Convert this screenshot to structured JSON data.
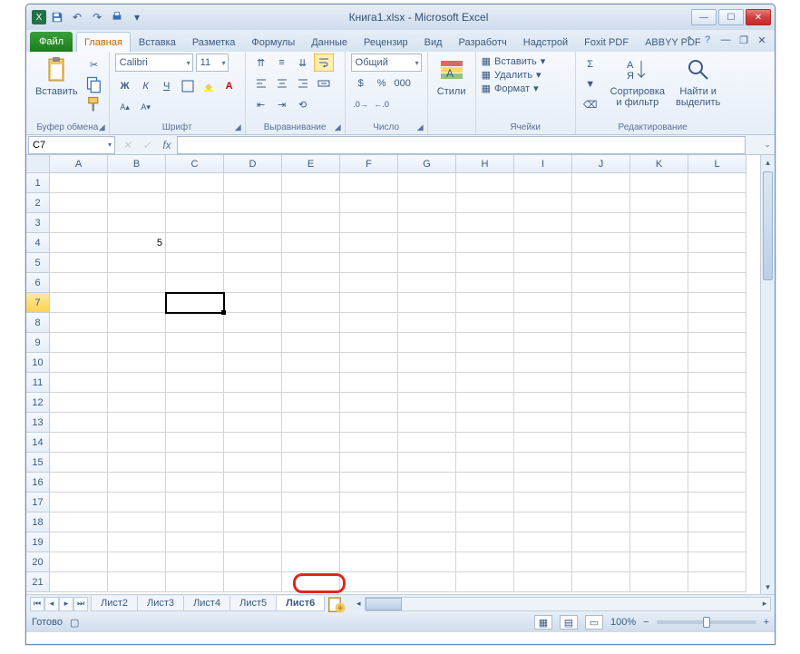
{
  "titlebar": {
    "title": "Книга1.xlsx - Microsoft Excel"
  },
  "tabs": {
    "file": "Файл",
    "items": [
      "Главная",
      "Вставка",
      "Разметка",
      "Формулы",
      "Данные",
      "Рецензир",
      "Вид",
      "Разработч",
      "Надстрой",
      "Foxit PDF",
      "ABBYY PDF"
    ],
    "active_index": 0
  },
  "ribbon": {
    "clipboard": {
      "paste": "Вставить",
      "label": "Буфер обмена"
    },
    "font": {
      "name": "Calibri",
      "size": "11",
      "bold": "Ж",
      "italic": "К",
      "underline": "Ч",
      "label": "Шрифт"
    },
    "alignment": {
      "label": "Выравнивание"
    },
    "number": {
      "format": "Общий",
      "label": "Число"
    },
    "styles": {
      "btn": "Стили",
      "label": ""
    },
    "cells": {
      "insert": "Вставить",
      "delete": "Удалить",
      "format": "Формат",
      "label": "Ячейки"
    },
    "editing": {
      "sort": "Сортировка\nи фильтр",
      "find": "Найти и\nвыделить",
      "label": "Редактирование"
    }
  },
  "namebox": "C7",
  "fx_label": "fx",
  "columns": [
    "A",
    "B",
    "C",
    "D",
    "E",
    "F",
    "G",
    "H",
    "I",
    "J",
    "K",
    "L"
  ],
  "row_count": 21,
  "cells": {
    "B4": "5"
  },
  "selected_cell": "C7",
  "sheets": {
    "tabs": [
      "Лист2",
      "Лист3",
      "Лист4",
      "Лист5",
      "Лист6"
    ],
    "active_index": 4
  },
  "status": {
    "ready": "Готово",
    "zoom": "100%"
  }
}
